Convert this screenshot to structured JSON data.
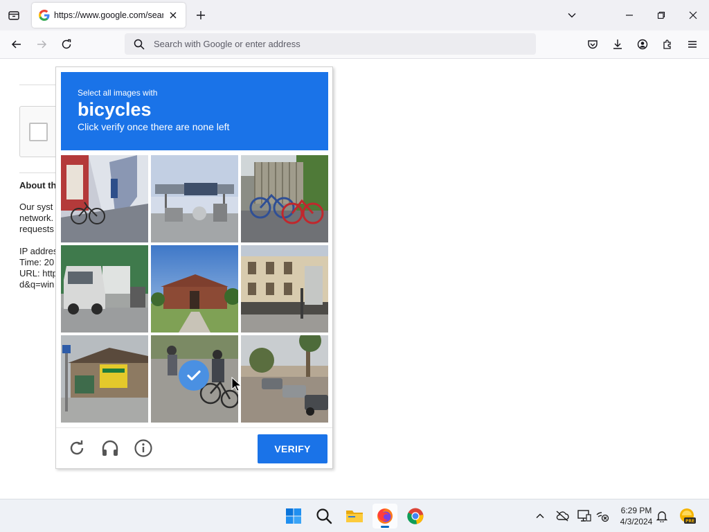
{
  "browser": {
    "tab": {
      "title": "https://www.google.com/search?q=",
      "favicon": "google-g-icon"
    },
    "urlbar": {
      "placeholder": "Search with Google or enter address",
      "value": ""
    }
  },
  "background_page": {
    "about_title": "About th",
    "paragraph": [
      "Our syst",
      "network.",
      "requests"
    ],
    "details": [
      "IP addres",
      "Time: 20",
      "URL: http",
      "d&q=win"
    ]
  },
  "challenge": {
    "instruction_line1": "Select all images with",
    "target_object": "bicycles",
    "instruction_line3": "Click verify once there are none left",
    "tiles": [
      {
        "index": 1,
        "scene": "storefront stairs with parked bicycle",
        "selected": false
      },
      {
        "index": 2,
        "scene": "highway sign gantry and industrial skyline",
        "selected": false
      },
      {
        "index": 3,
        "scene": "two bicycles parked by a fence",
        "selected": false
      },
      {
        "index": 4,
        "scene": "white van on street",
        "selected": false
      },
      {
        "index": 5,
        "scene": "brick house with lawn and blue sky",
        "selected": false
      },
      {
        "index": 6,
        "scene": "city building with sidewalk",
        "selected": false
      },
      {
        "index": 7,
        "scene": "shop with yellow signs",
        "selected": false
      },
      {
        "index": 8,
        "scene": "cyclists on road",
        "selected": true
      },
      {
        "index": 9,
        "scene": "parked cars on palm-lined street",
        "selected": false
      }
    ],
    "verify_label": "VERIFY",
    "colors": {
      "accent": "#1a73e8",
      "check": "#4a90e2"
    }
  },
  "taskbar": {
    "clock_time": "6:29 PM",
    "clock_date": "4/3/2024"
  }
}
